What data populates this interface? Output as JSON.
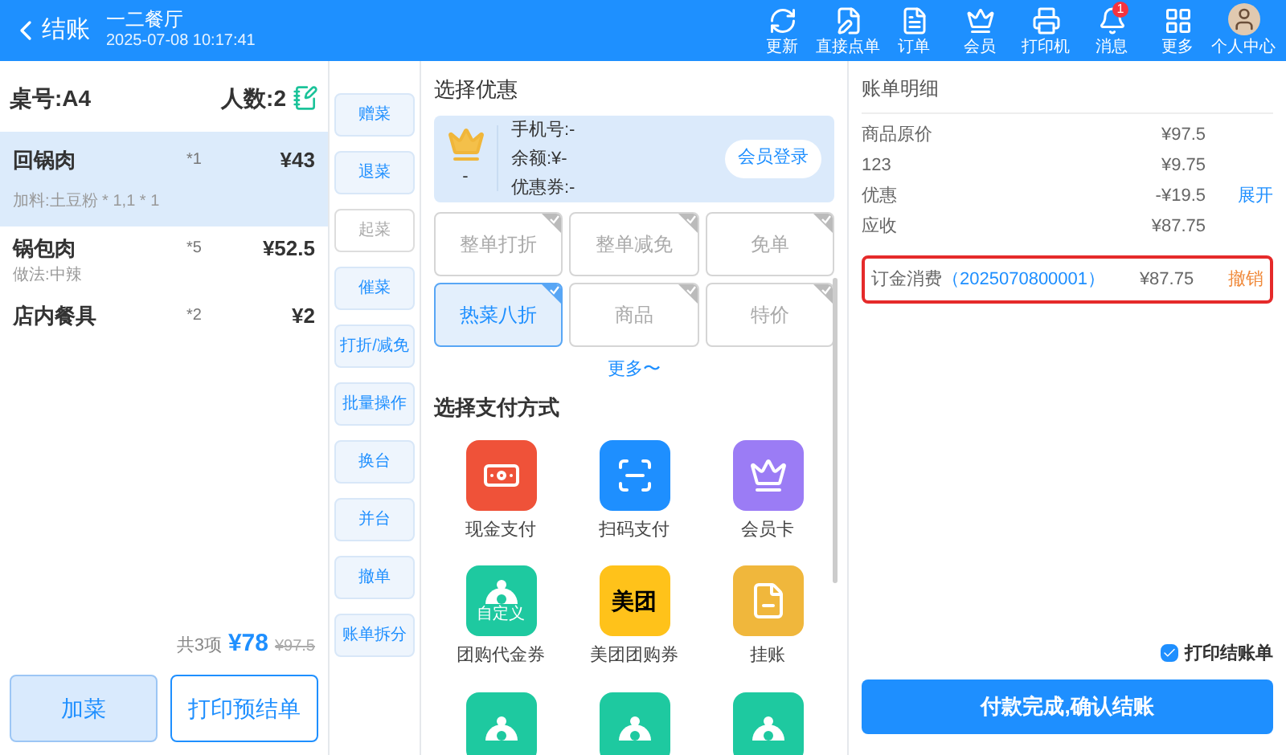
{
  "header": {
    "back_label": "结账",
    "title": "一二餐厅",
    "datetime": "2025-07-08 10:17:41",
    "tools": [
      {
        "kind": "refresh",
        "label": "更新"
      },
      {
        "kind": "order-direct",
        "label": "直接点单"
      },
      {
        "kind": "orders",
        "label": "订单"
      },
      {
        "kind": "member",
        "label": "会员"
      },
      {
        "kind": "printer",
        "label": "打印机"
      },
      {
        "kind": "messages",
        "label": "消息",
        "badge": "1"
      },
      {
        "kind": "more",
        "label": "更多"
      },
      {
        "kind": "profile",
        "label": "个人中心"
      }
    ]
  },
  "order": {
    "table": "桌号:A4",
    "guests": "人数:2",
    "items": [
      {
        "name": "回锅肉",
        "qty": "*1",
        "price": "¥43",
        "note": "加料:土豆粉 * 1,1 * 1",
        "selected": true
      },
      {
        "name": "锅包肉",
        "qty": "*5",
        "price": "¥52.5",
        "note": "做法:中辣",
        "selected": false
      },
      {
        "name": "店内餐具",
        "qty": "*2",
        "price": "¥2",
        "selected": false
      }
    ],
    "count": "共3项",
    "total": "¥78",
    "original_total": "¥97.5",
    "buttons": [
      {
        "label": "加菜",
        "kind": "primary"
      },
      {
        "label": "打印预结单",
        "kind": "outline"
      }
    ]
  },
  "actions": [
    {
      "label": "赠菜",
      "disabled": false
    },
    {
      "label": "退菜",
      "disabled": false
    },
    {
      "label": "起菜",
      "disabled": true
    },
    {
      "label": "催菜",
      "disabled": false
    },
    {
      "label": "打折/减免",
      "disabled": false
    },
    {
      "label": "批量操作",
      "disabled": false
    },
    {
      "label": "换台",
      "disabled": false
    },
    {
      "label": "并台",
      "disabled": false
    },
    {
      "label": "撤单",
      "disabled": false
    },
    {
      "label": "账单拆分",
      "disabled": false
    }
  ],
  "discounts": {
    "title": "选择优惠",
    "member": {
      "name": "-",
      "phone": "手机号:-",
      "balance": "余额:¥-",
      "coupons": "优惠券:-",
      "login": "会员登录"
    },
    "options": [
      {
        "label": "整单打折",
        "selected": false
      },
      {
        "label": "整单减免",
        "selected": false
      },
      {
        "label": "免单",
        "selected": false
      },
      {
        "label": "热菜八折",
        "selected": true
      },
      {
        "label": "商品",
        "selected": false
      },
      {
        "label": "特价",
        "selected": false
      }
    ],
    "more": "更多〜"
  },
  "payment": {
    "title": "选择支付方式",
    "methods": [
      {
        "kind": "cash",
        "label": "现金支付"
      },
      {
        "kind": "scan",
        "label": "扫码支付"
      },
      {
        "kind": "member-card",
        "label": "会员卡"
      },
      {
        "kind": "custom",
        "label": "团购代金券",
        "tag": "自定义"
      },
      {
        "kind": "meituan",
        "label": "美团团购券",
        "logo": "美团"
      },
      {
        "kind": "credit",
        "label": "挂账"
      },
      {
        "kind": "custom"
      },
      {
        "kind": "custom"
      },
      {
        "kind": "custom"
      }
    ]
  },
  "bill": {
    "title": "账单明细",
    "rows": [
      {
        "label": "商品原价",
        "amount": "¥97.5"
      },
      {
        "label": "123",
        "amount": "¥9.75"
      },
      {
        "label": "优惠",
        "amount": "-¥19.5",
        "action": "展开"
      },
      {
        "label": "应收",
        "amount": "¥87.75"
      }
    ],
    "deposit": {
      "label": "订金消费",
      "code": "（2025070800001）",
      "amount": "¥87.75",
      "action": "撤销"
    },
    "print_receipt": {
      "label": "打印结账单",
      "checked": true
    },
    "confirm": "付款完成,确认结账"
  }
}
